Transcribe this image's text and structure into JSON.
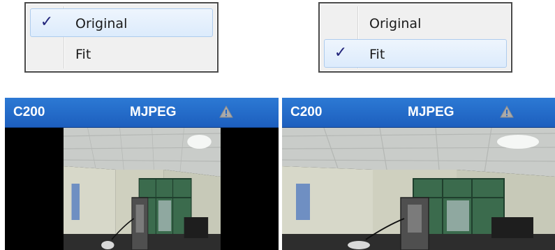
{
  "menus": [
    {
      "items": [
        {
          "label": "Original",
          "checked": true
        },
        {
          "label": "Fit",
          "checked": false
        }
      ]
    },
    {
      "items": [
        {
          "label": "Original",
          "checked": false
        },
        {
          "label": "Fit",
          "checked": true
        }
      ]
    }
  ],
  "check_glyph": "✓",
  "cameras": [
    {
      "name": "C200",
      "codec": "MJPEG",
      "status_icon": "warning-icon",
      "mode": "Original"
    },
    {
      "name": "C200",
      "codec": "MJPEG",
      "status_icon": "warning-icon",
      "mode": "Fit"
    }
  ],
  "colors": {
    "header_blue": "#1f66c6",
    "selection_border": "#aeccee",
    "check_mark": "#21247a",
    "warning_triangle": "#a9a9a9"
  }
}
